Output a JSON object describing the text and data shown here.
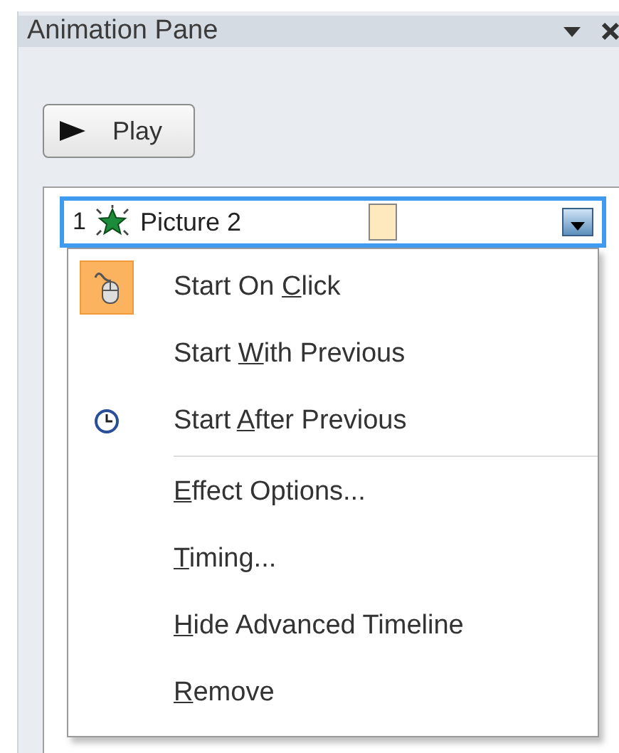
{
  "pane": {
    "title": "Animation Pane"
  },
  "play_button": {
    "label": "Play"
  },
  "animation_list": [
    {
      "number": "1",
      "name": "Picture 2",
      "selected": true
    }
  ],
  "context_menu": [
    {
      "kind": "click",
      "before": "Start On ",
      "access_key": "C",
      "after": "lick",
      "checked": true
    },
    {
      "kind": "with",
      "before": "Start ",
      "access_key": "W",
      "after": "ith Previous",
      "checked": false
    },
    {
      "kind": "after",
      "before": "Start ",
      "access_key": "A",
      "after": "fter Previous",
      "checked": false
    },
    {
      "kind": "separator"
    },
    {
      "kind": "command",
      "access_key": "E",
      "after": "ffect Options..."
    },
    {
      "kind": "command",
      "access_key": "T",
      "after": "iming..."
    },
    {
      "kind": "command",
      "access_key": "H",
      "after": "ide Advanced Timeline"
    },
    {
      "kind": "command",
      "access_key": "R",
      "after": "emove"
    }
  ]
}
